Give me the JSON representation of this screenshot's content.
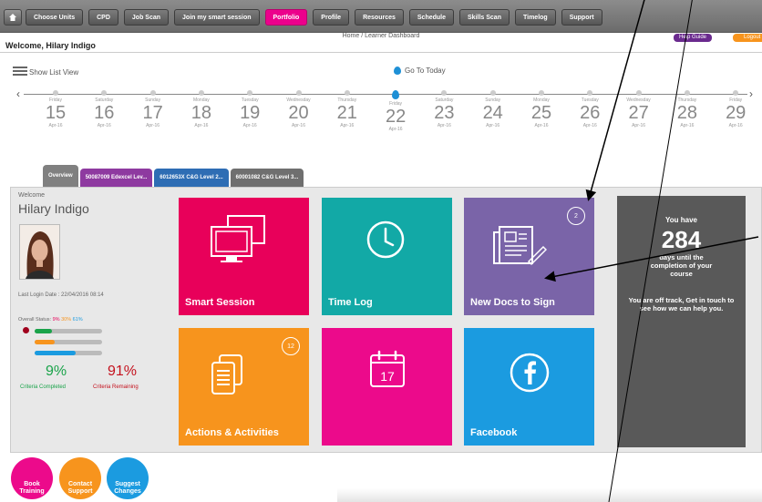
{
  "nav": {
    "items": [
      {
        "label": "Choose Units"
      },
      {
        "label": "CPD"
      },
      {
        "label": "Job Scan"
      },
      {
        "label": "Join my smart session"
      },
      {
        "label": "Portfolio",
        "active": true
      },
      {
        "label": "Profile"
      },
      {
        "label": "Resources"
      },
      {
        "label": "Schedule"
      },
      {
        "label": "Skills Scan"
      },
      {
        "label": "Timelog"
      },
      {
        "label": "Support"
      }
    ],
    "breadcrumb": "Home / Learner Dashboard",
    "help_label": "Help Guide",
    "logout_label": "Logout"
  },
  "header": {
    "welcome": "Welcome, Hilary Indigo"
  },
  "toolbar": {
    "list_view": "Show List View",
    "go_today": "Go To Today"
  },
  "timeline": {
    "days": [
      {
        "wd": "Friday",
        "num": "15",
        "mo": "Apr-16"
      },
      {
        "wd": "Saturday",
        "num": "16",
        "mo": "Apr-16"
      },
      {
        "wd": "Sunday",
        "num": "17",
        "mo": "Apr-16"
      },
      {
        "wd": "Monday",
        "num": "18",
        "mo": "Apr-16"
      },
      {
        "wd": "Tuesday",
        "num": "19",
        "mo": "Apr-16"
      },
      {
        "wd": "Wednesday",
        "num": "20",
        "mo": "Apr-16"
      },
      {
        "wd": "Thursday",
        "num": "21",
        "mo": "Apr-16"
      },
      {
        "wd": "Friday",
        "num": "22",
        "mo": "Apr-16",
        "current": true
      },
      {
        "wd": "Saturday",
        "num": "23",
        "mo": "Apr-16"
      },
      {
        "wd": "Sunday",
        "num": "24",
        "mo": "Apr-16"
      },
      {
        "wd": "Monday",
        "num": "25",
        "mo": "Apr-16"
      },
      {
        "wd": "Tuesday",
        "num": "26",
        "mo": "Apr-16"
      },
      {
        "wd": "Wednesday",
        "num": "27",
        "mo": "Apr-16"
      },
      {
        "wd": "Thursday",
        "num": "28",
        "mo": "Apr-16"
      },
      {
        "wd": "Friday",
        "num": "29",
        "mo": "Apr-16"
      }
    ]
  },
  "tabs": [
    {
      "label": "Overview",
      "color": "#808080"
    },
    {
      "label": "50087009 Edexcel Lev...",
      "color": "#8e3aa0"
    },
    {
      "label": "6012653X C&G Level 2...",
      "color": "#2e6db4"
    },
    {
      "label": "60001082 C&G Level 3...",
      "color": "#6f6f6f"
    }
  ],
  "profile": {
    "welcome_label": "Welcome",
    "name": "Hilary Indigo",
    "last_login": "Last Login Date : 22/04/2016 08:14",
    "overall_status_label": "Overall Status:",
    "status_red": "9%",
    "status_orange": "30%",
    "status_blue": "61%",
    "completed_pct": "9%",
    "completed_label": "Criteria Completed",
    "remaining_pct": "91%",
    "remaining_label": "Criteria Remaining"
  },
  "tiles": {
    "smart_session": "Smart Session",
    "time_log": "Time Log",
    "new_docs": "New Docs to Sign",
    "new_docs_count": "2",
    "actions": "Actions & Activities",
    "actions_count": "12",
    "calendar_day": "17",
    "facebook": "Facebook"
  },
  "countdown": {
    "you_have": "You have",
    "days": "284",
    "until": "days until the completion of your course",
    "off_track": "You are off track, Get in touch to see how we can help you."
  },
  "buttons": {
    "book_training": "Book Training",
    "contact_support": "Contact Support",
    "suggest_changes": "Suggest Changes"
  },
  "colors": {
    "pink": "#e8005a",
    "magenta": "#ec0a8b",
    "teal": "#12a9a6",
    "purple": "#7a64a8",
    "orange": "#f7941d",
    "blue": "#1b9be0",
    "gray_panel": "#595959"
  }
}
